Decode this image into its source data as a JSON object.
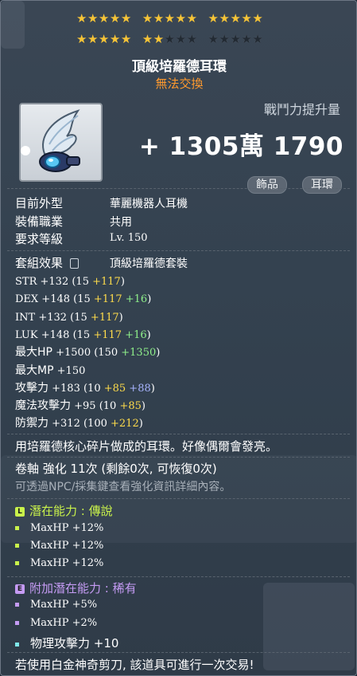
{
  "stars": {
    "row1": [
      [
        1,
        1,
        1,
        1,
        1
      ],
      [
        1,
        1,
        1,
        1,
        1
      ],
      [
        1,
        1,
        1,
        1,
        1
      ]
    ],
    "row2": [
      [
        1,
        1,
        1,
        1,
        1
      ],
      [
        1,
        1,
        0,
        0,
        0
      ],
      [
        0,
        0,
        0,
        0,
        0
      ]
    ],
    "count": 22
  },
  "item": {
    "name": "頂級培羅德耳環",
    "trade": "無法交換",
    "icon": "winged-earring-icon"
  },
  "power": {
    "label": "戰鬥力提升量",
    "value": "+ 1305萬 1790"
  },
  "tags": [
    "飾品",
    "耳環"
  ],
  "info": [
    {
      "label": "目前外型",
      "value": "華麗機器人耳機"
    },
    {
      "label": "裝備職業",
      "value": "共用"
    },
    {
      "label": "要求等級",
      "value": "Lv. 150"
    }
  ],
  "set": {
    "label": "套組效果",
    "value": "頂級培羅德套裝"
  },
  "stats": [
    {
      "name": "STR",
      "total": "+132",
      "base": "(15",
      "bonus1": "+117",
      "bonus2": "",
      "close": ")"
    },
    {
      "name": "DEX",
      "total": "+148",
      "base": "(15",
      "bonus1": "+117",
      "bonus2": "+16",
      "close": ")"
    },
    {
      "name": "INT",
      "total": "+132",
      "base": "(15",
      "bonus1": "+117",
      "bonus2": "",
      "close": ")"
    },
    {
      "name": "LUK",
      "total": "+148",
      "base": "(15",
      "bonus1": "+117",
      "bonus2": "+16",
      "close": ")"
    },
    {
      "name": "最大HP",
      "total": "+1500",
      "base": "(150",
      "bonus1": "",
      "bonus2": "+1350",
      "close": ")"
    },
    {
      "name": "最大MP",
      "total": "+150",
      "base": "",
      "bonus1": "",
      "bonus2": "",
      "close": ""
    },
    {
      "name": "攻擊力",
      "total": "+183",
      "base": "(10",
      "bonus1": "+85",
      "bonus2": "",
      "bonus3": "+88",
      "close": ")"
    },
    {
      "name": "魔法攻擊力",
      "total": "+95",
      "base": "(10",
      "bonus1": "+85",
      "bonus2": "",
      "close": ")"
    },
    {
      "name": "防禦力",
      "total": "+312",
      "base": "(100",
      "bonus1": "+212",
      "bonus2": "",
      "close": ")"
    }
  ],
  "description": "用培羅德核心碎片做成的耳環。好像偶爾會發亮。",
  "scroll": "卷軸 強化 11次 (剩餘0次, 可恢復0次)",
  "hint": "可透過NPC/採集鍵查看強化資訊詳細內容。",
  "potential": {
    "badge": "L",
    "title": "潛在能力 : 傳說",
    "color": "#c9f24b",
    "lines": [
      "MaxHP +12%",
      "MaxHP +12%",
      "MaxHP +12%"
    ]
  },
  "additional": {
    "badge": "E",
    "title": "附加潛在能力 : 稀有",
    "color": "#c59bf4",
    "lines": [
      "MaxHP +5%",
      "MaxHP +2%",
      "物理攻擊力 +10"
    ],
    "bullet_colors": [
      "#c59bf4",
      "#c59bf4",
      "#7fe8ea"
    ]
  },
  "footer": "若使用白金神奇剪刀, 該道具可進行一次交易!"
}
